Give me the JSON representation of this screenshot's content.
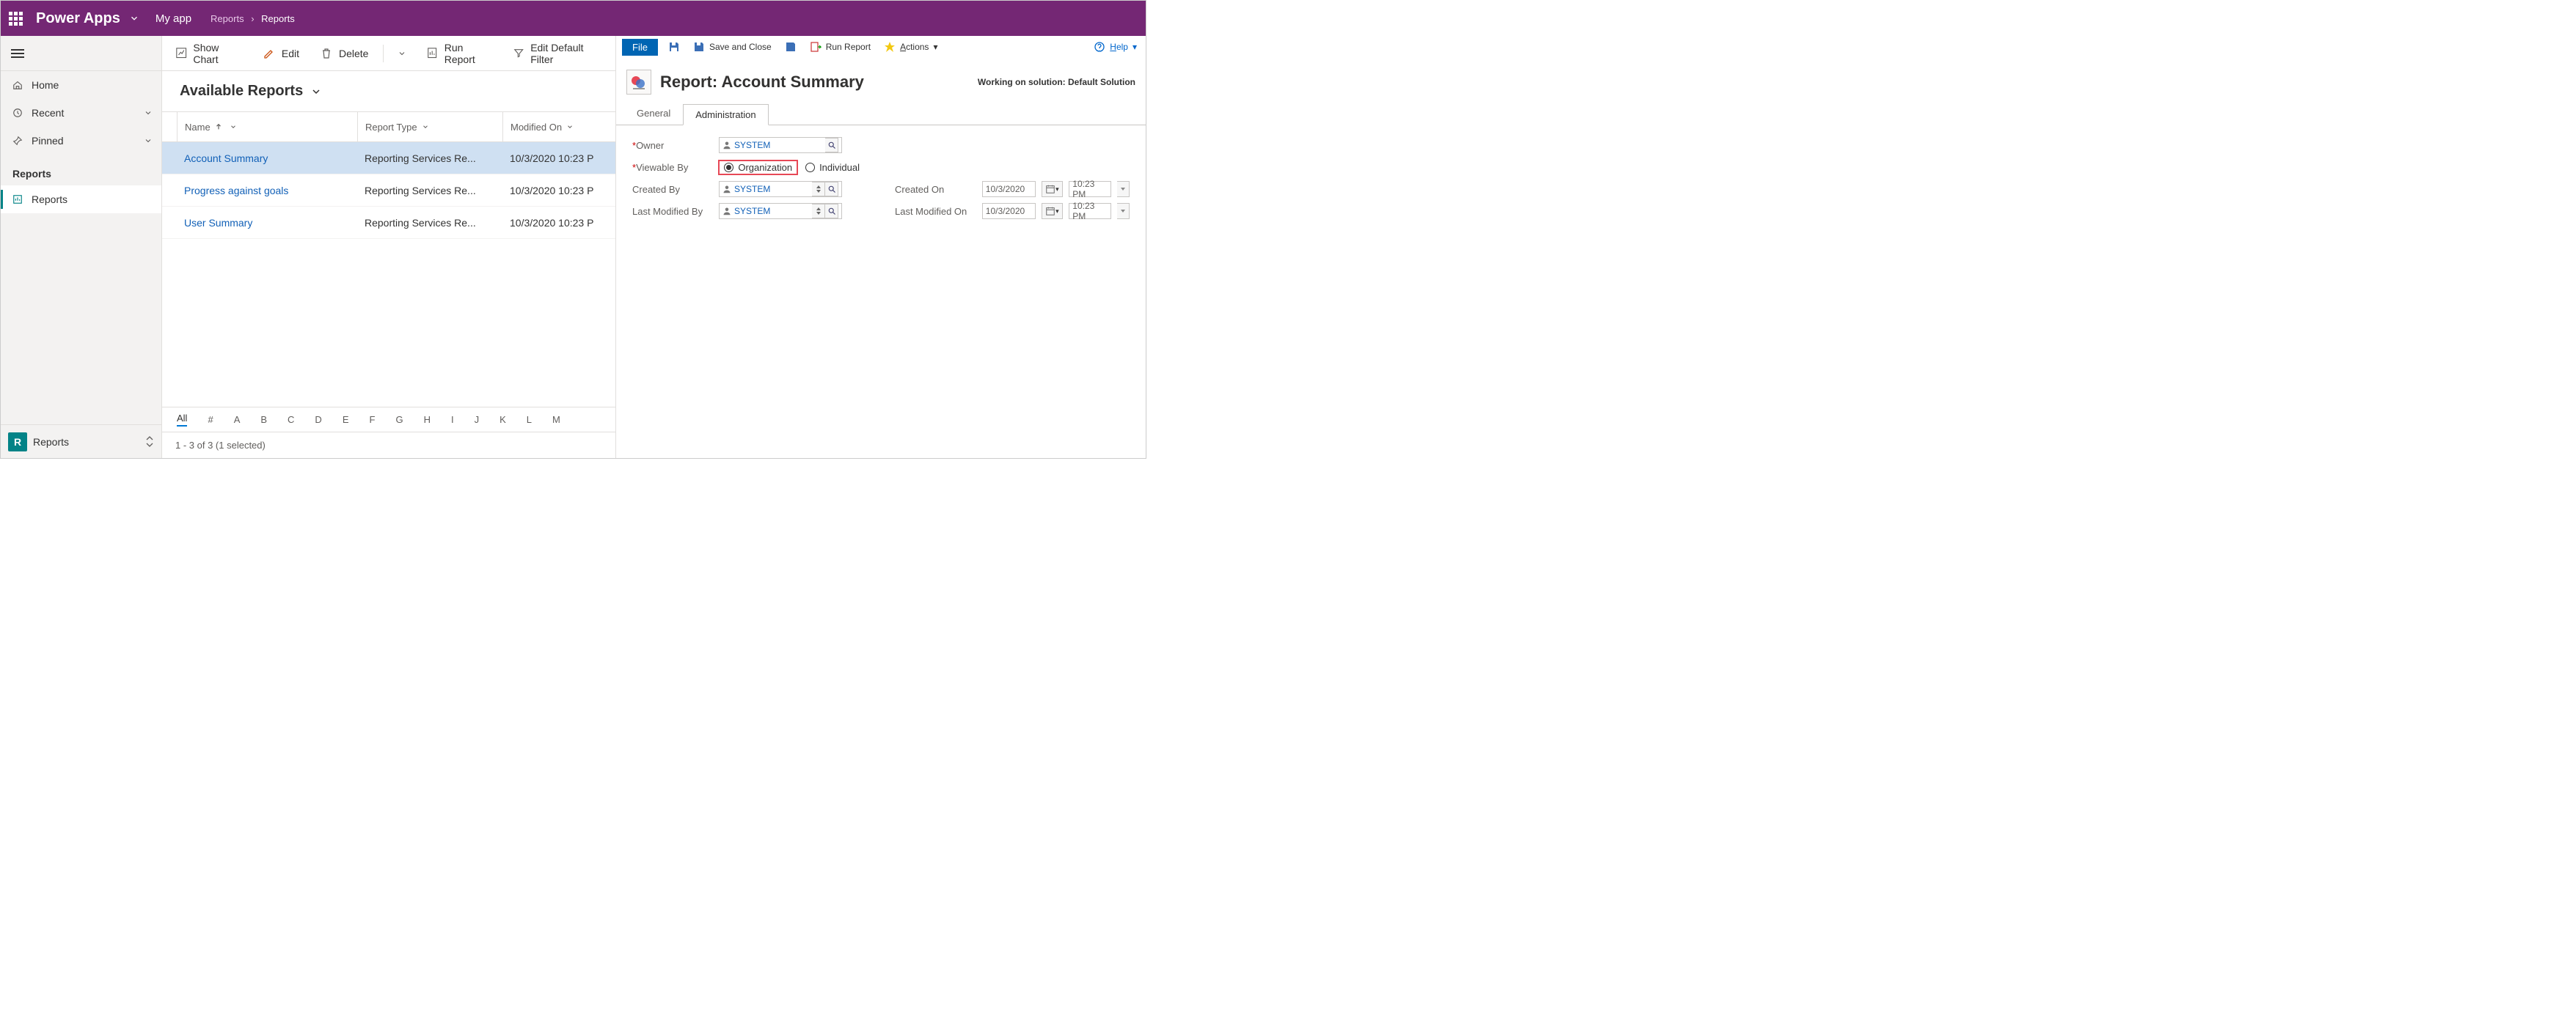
{
  "header": {
    "brand": "Power Apps",
    "app_name": "My app",
    "breadcrumb_parent": "Reports",
    "breadcrumb_current": "Reports"
  },
  "nav": {
    "home": "Home",
    "recent": "Recent",
    "pinned": "Pinned",
    "section": "Reports",
    "reports": "Reports",
    "footer_env_letter": "R",
    "footer_label": "Reports"
  },
  "commands": {
    "show_chart": "Show Chart",
    "edit": "Edit",
    "delete": "Delete",
    "run_report": "Run Report",
    "edit_default_filter": "Edit Default Filter"
  },
  "list": {
    "title": "Available Reports",
    "columns": {
      "name": "Name",
      "report_type": "Report Type",
      "modified_on": "Modified On"
    },
    "rows": [
      {
        "name": "Account Summary",
        "type": "Reporting Services Re...",
        "modified": "10/3/2020 10:23 P",
        "selected": true
      },
      {
        "name": "Progress against goals",
        "type": "Reporting Services Re...",
        "modified": "10/3/2020 10:23 P",
        "selected": false
      },
      {
        "name": "User Summary",
        "type": "Reporting Services Re...",
        "modified": "10/3/2020 10:23 P",
        "selected": false
      }
    ],
    "alpha": [
      "All",
      "#",
      "A",
      "B",
      "C",
      "D",
      "E",
      "F",
      "G",
      "H",
      "I",
      "J",
      "K",
      "L",
      "M"
    ],
    "status": "1 - 3 of 3 (1 selected)"
  },
  "detail": {
    "ribbon": {
      "file": "File",
      "save_close": "Save and Close",
      "run_report": "Run Report",
      "actions": "Actions",
      "help": "Help"
    },
    "title": "Report: Account Summary",
    "solution_note": "Working on solution: Default Solution",
    "tabs": {
      "general": "General",
      "administration": "Administration"
    },
    "labels": {
      "owner": "Owner",
      "viewable_by": "Viewable By",
      "created_by": "Created By",
      "last_modified_by": "Last Modified By",
      "created_on": "Created On",
      "last_modified_on": "Last Modified On",
      "organization": "Organization",
      "individual": "Individual"
    },
    "values": {
      "owner": "SYSTEM",
      "created_by": "SYSTEM",
      "last_modified_by": "SYSTEM",
      "created_on_date": "10/3/2020",
      "created_on_time": "10:23 PM",
      "last_modified_on_date": "10/3/2020",
      "last_modified_on_time": "10:23 PM"
    }
  }
}
